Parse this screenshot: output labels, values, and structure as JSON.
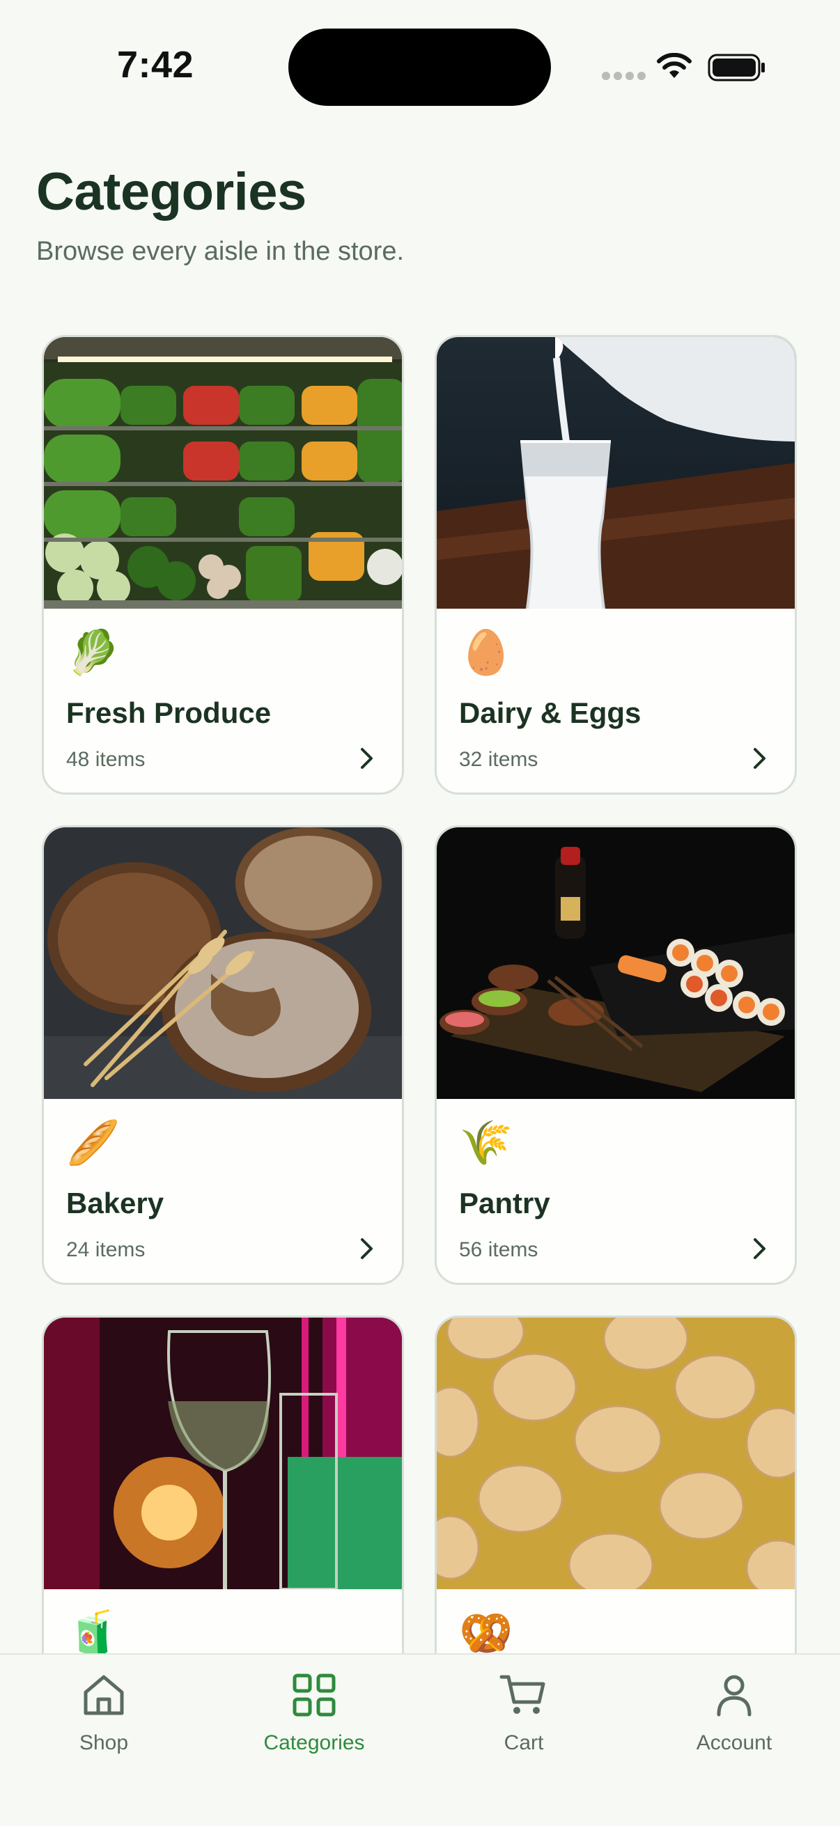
{
  "status_bar": {
    "time": "7:42"
  },
  "header": {
    "title": "Categories",
    "subtitle": "Browse every aisle in the store."
  },
  "categories": [
    {
      "name": "Fresh Produce",
      "count": "48 items",
      "emoji": "🥬",
      "image": "produce-shelves-photo"
    },
    {
      "name": "Dairy & Eggs",
      "count": "32 items",
      "emoji": "🥚",
      "image": "milk-pour-photo"
    },
    {
      "name": "Bakery",
      "count": "24 items",
      "emoji": "🥖",
      "image": "bread-loaves-photo"
    },
    {
      "name": "Pantry",
      "count": "56 items",
      "emoji": "🌾",
      "image": "sushi-platter-photo"
    },
    {
      "name": "",
      "count": "",
      "emoji": "🧃",
      "image": "wine-glasses-photo"
    },
    {
      "name": "",
      "count": "",
      "emoji": "🥨",
      "image": "potato-chips-photo"
    }
  ],
  "tab_bar": {
    "active": "Categories",
    "tabs": [
      {
        "label": "Shop",
        "icon": "home-icon"
      },
      {
        "label": "Categories",
        "icon": "grid-icon"
      },
      {
        "label": "Cart",
        "icon": "cart-icon"
      },
      {
        "label": "Account",
        "icon": "person-icon"
      }
    ]
  },
  "colors": {
    "accent": "#2f8a3c",
    "title": "#1b3322",
    "muted": "#5b6b60",
    "background": "#f6f9f4",
    "card": "#fefffc"
  }
}
